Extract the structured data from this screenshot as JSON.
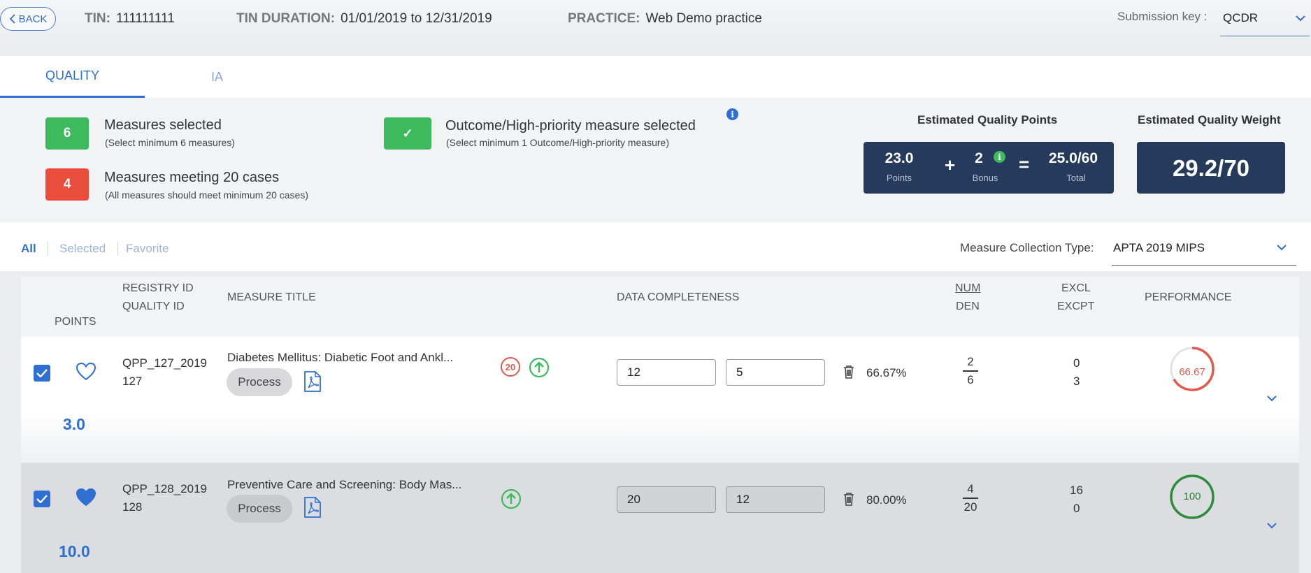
{
  "header": {
    "back_label": "BACK",
    "tin_label": "TIN:",
    "tin_value": "111111111",
    "duration_label": "TIN DURATION:",
    "duration_value": "01/01/2019 to 12/31/2019",
    "practice_label": "PRACTICE:",
    "practice_value": "Web Demo practice",
    "submission_key_label": "Submission key :",
    "submission_key_value": "QCDR"
  },
  "tabs": [
    {
      "label": "QUALITY",
      "active": true
    },
    {
      "label": "IA",
      "active": false
    }
  ],
  "summary": {
    "measures_selected": {
      "count": "6",
      "title": "Measures selected",
      "sub": "(Select minimum 6 measures)",
      "color": "#3dba5c"
    },
    "measures_meeting": {
      "count": "4",
      "title": "Measures meeting 20 cases",
      "sub": "(All measures should meet minimum 20 cases)",
      "color": "#e94e3c"
    },
    "outcome": {
      "mark": "✓",
      "title": "Outcome/High-priority measure selected",
      "sub": "(Select minimum 1 Outcome/High-priority measure)"
    },
    "info_glyph": "i"
  },
  "estimates": {
    "points_label": "Estimated Quality Points",
    "points": "23.0",
    "points_cap": "Points",
    "plus": "+",
    "bonus": "2",
    "bonus_cap": "Bonus",
    "equals": "=",
    "total": "25.0/60",
    "total_cap": "Total",
    "weight_label": "Estimated Quality Weight",
    "weight": "29.2/70"
  },
  "filters": {
    "all": "All",
    "selected": "Selected",
    "favorite": "Favorite",
    "collection_label": "Measure Collection Type:",
    "collection_value": "APTA 2019 MIPS"
  },
  "columns": {
    "points": "POINTS",
    "registry_id": "REGISTRY ID",
    "quality_id": "QUALITY ID",
    "measure_title": "MEASURE TITLE",
    "data_completeness": "DATA COMPLETENESS",
    "num": "NUM",
    "den": "DEN",
    "excl": "EXCL",
    "excpt": "EXCPT",
    "performance": "PERFORMANCE"
  },
  "rows": [
    {
      "registry_id": "QPP_127_2019",
      "quality_id": "127",
      "title": "Diabetes Mellitus: Diabetic Foot and Ankl...",
      "type": "Process",
      "badge_20": "20",
      "dc_num": "12",
      "dc_den": "5",
      "completeness": "66.67%",
      "num": "2",
      "den": "6",
      "excl": "0",
      "excpt": "3",
      "performance": "66.67",
      "performance_fraction": 0.6667,
      "points": "3.0",
      "favorite": false,
      "checked": true
    },
    {
      "registry_id": "QPP_128_2019",
      "quality_id": "128",
      "title": "Preventive Care and Screening: Body Mas...",
      "type": "Process",
      "dc_num": "20",
      "dc_den": "12",
      "completeness": "80.00%",
      "num": "4",
      "den": "20",
      "excl": "16",
      "excpt": "0",
      "performance": "100",
      "performance_fraction": 1.0,
      "points": "10.0",
      "favorite": true,
      "checked": true
    }
  ],
  "colors": {
    "accent": "#2f6fd1",
    "green": "#3dba5c",
    "red": "#e94e3c",
    "navy": "#263a5c"
  }
}
